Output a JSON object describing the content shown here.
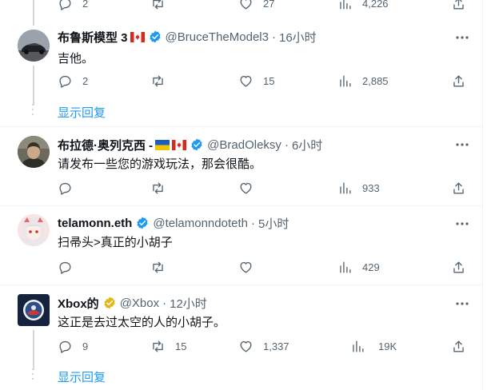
{
  "top_actions": {
    "reply_count": "2",
    "retweet_count": "",
    "like_count": "27",
    "view_count": "4,226"
  },
  "tweets": [
    {
      "name": "布鲁斯模型 3",
      "handle": "@BruceTheModel3",
      "sep": "·",
      "time": "16小时",
      "text": "吉他。",
      "reply_count": "2",
      "retweet_count": "",
      "like_count": "15",
      "view_count": "2,885",
      "show_replies": "显示回复"
    },
    {
      "name": "布拉德·奥列克西 -",
      "handle": "@BradOleksy",
      "sep": "·",
      "time": "6小时",
      "text": "请发布一些您的游戏玩法，那会很酷。",
      "reply_count": "",
      "retweet_count": "",
      "like_count": "",
      "view_count": "933"
    },
    {
      "name": "telamonn.eth",
      "handle": "@telamonndoteth",
      "sep": "·",
      "time": "5小时",
      "text": "扫帚头>真正的小胡子",
      "reply_count": "",
      "retweet_count": "",
      "like_count": "",
      "view_count": "429"
    },
    {
      "name": "Xbox的",
      "handle": "@Xbox",
      "sep": "·",
      "time": "12小时",
      "text": "这正是去过太空的人的小胡子。",
      "reply_count": "9",
      "retweet_count": "15",
      "like_count": "1,337",
      "view_count": "19K",
      "show_replies": "显示回复"
    }
  ],
  "colors": {
    "accent": "#1d9bf0",
    "muted": "#536471",
    "verified_blue": "#1d9bf0",
    "verified_gold": "#e2b719"
  },
  "icons": [
    "reply-icon",
    "retweet-icon",
    "like-icon",
    "views-icon",
    "share-icon",
    "more-icon",
    "verified-badge-icon",
    "canada-flag-icon",
    "ukraine-flag-icon"
  ]
}
